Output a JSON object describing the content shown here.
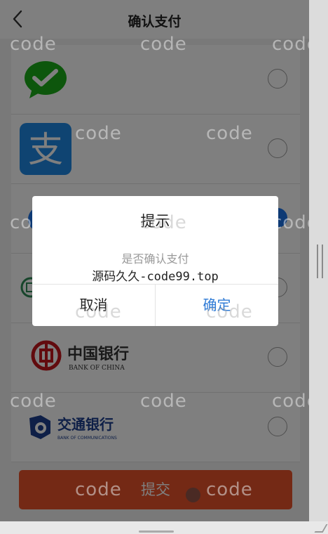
{
  "header": {
    "title": "确认支付",
    "back_icon": "chevron-left-icon"
  },
  "payment_methods": [
    {
      "id": "wechat",
      "icon": "wechat-pay-icon",
      "selected": false,
      "brand_color": "#1aad19"
    },
    {
      "id": "alipay",
      "icon": "alipay-icon",
      "selected": false,
      "brand_color": "#1e88e5"
    },
    {
      "id": "hidden-blue",
      "icon": "bank-icon",
      "selected": true,
      "brand_color": "#1a73e8"
    },
    {
      "id": "hidden-green",
      "icon": "bank-icon",
      "selected": false,
      "brand_color": "#2e8b57"
    },
    {
      "id": "boc",
      "icon": "bank-of-china-logo",
      "zh_name": "中国银行",
      "en_name": "BANK OF CHINA",
      "selected": false,
      "brand_color": "#c4161c"
    },
    {
      "id": "bocom",
      "icon": "bank-of-communications-logo",
      "zh_name": "交通银行",
      "en_name": "BANK OF COMMUNICATIONS",
      "selected": false,
      "brand_color": "#1d3f8f"
    }
  ],
  "submit": {
    "label": "提交",
    "color": "#e8532a"
  },
  "dialog": {
    "title": "提示",
    "message": "是否确认支付",
    "note": "源码久久-code99.top",
    "cancel_label": "取消",
    "confirm_label": "确定",
    "confirm_color": "#2f7bd6"
  },
  "watermark": {
    "text": "code"
  }
}
